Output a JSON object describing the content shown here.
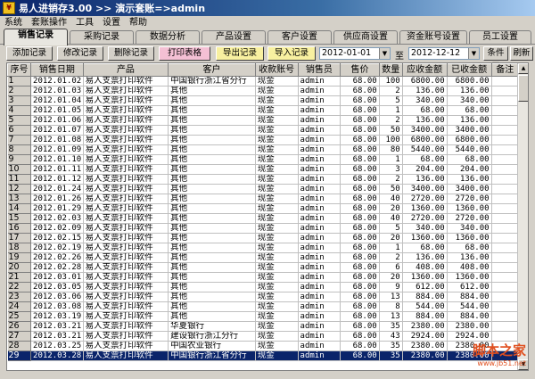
{
  "window": {
    "title": "易人进销存3.00 >> 演示套账=>admin"
  },
  "menu": [
    "系统",
    "套账操作",
    "工具",
    "设置",
    "帮助"
  ],
  "tabs": [
    {
      "label": "销售记录",
      "active": true
    },
    {
      "label": "采购记录"
    },
    {
      "label": "数据分析"
    },
    {
      "label": "产品设置"
    },
    {
      "label": "客户设置"
    },
    {
      "label": "供应商设置"
    },
    {
      "label": "资金账号设置"
    },
    {
      "label": "员工设置"
    }
  ],
  "toolbar": {
    "add": "添加记录",
    "edit": "修改记录",
    "delete": "删除记录",
    "print": "打印表格",
    "export": "导出记录",
    "import": "导入记录",
    "date_from": "2012-01-01",
    "to_label": "至",
    "date_to": "2012-12-12",
    "condition": "条件▼",
    "refresh": "刷新"
  },
  "table": {
    "columns": [
      "序号",
      "销售日期",
      "产品",
      "客户",
      "收款账号",
      "销售员",
      "售价",
      "数量",
      "应收金额",
      "已收金额",
      "备注"
    ],
    "rows": [
      [
        "1",
        "2012.01.02",
        "易人支票打印软件",
        "中国银行浙江省分行",
        "现金",
        "admin",
        "68.00",
        "100",
        "6800.00",
        "6800.00",
        ""
      ],
      [
        "2",
        "2012.01.03",
        "易人支票打印软件",
        "其他",
        "现金",
        "admin",
        "68.00",
        "2",
        "136.00",
        "136.00",
        ""
      ],
      [
        "3",
        "2012.01.04",
        "易人支票打印软件",
        "其他",
        "现金",
        "admin",
        "68.00",
        "5",
        "340.00",
        "340.00",
        ""
      ],
      [
        "4",
        "2012.01.05",
        "易人支票打印软件",
        "其他",
        "现金",
        "admin",
        "68.00",
        "1",
        "68.00",
        "68.00",
        ""
      ],
      [
        "5",
        "2012.01.06",
        "易人支票打印软件",
        "其他",
        "现金",
        "admin",
        "68.00",
        "2",
        "136.00",
        "136.00",
        ""
      ],
      [
        "6",
        "2012.01.07",
        "易人支票打印软件",
        "其他",
        "现金",
        "admin",
        "68.00",
        "50",
        "3400.00",
        "3400.00",
        ""
      ],
      [
        "7",
        "2012.01.08",
        "易人支票打印软件",
        "其他",
        "现金",
        "admin",
        "68.00",
        "100",
        "6800.00",
        "6800.00",
        ""
      ],
      [
        "8",
        "2012.01.09",
        "易人支票打印软件",
        "其他",
        "现金",
        "admin",
        "68.00",
        "80",
        "5440.00",
        "5440.00",
        ""
      ],
      [
        "9",
        "2012.01.10",
        "易人支票打印软件",
        "其他",
        "现金",
        "admin",
        "68.00",
        "1",
        "68.00",
        "68.00",
        ""
      ],
      [
        "10",
        "2012.01.11",
        "易人支票打印软件",
        "其他",
        "现金",
        "admin",
        "68.00",
        "3",
        "204.00",
        "204.00",
        ""
      ],
      [
        "11",
        "2012.01.12",
        "易人支票打印软件",
        "其他",
        "现金",
        "admin",
        "68.00",
        "2",
        "136.00",
        "136.00",
        ""
      ],
      [
        "12",
        "2012.01.24",
        "易人支票打印软件",
        "其他",
        "现金",
        "admin",
        "68.00",
        "50",
        "3400.00",
        "3400.00",
        ""
      ],
      [
        "13",
        "2012.01.26",
        "易人支票打印软件",
        "其他",
        "现金",
        "admin",
        "68.00",
        "40",
        "2720.00",
        "2720.00",
        ""
      ],
      [
        "14",
        "2012.01.29",
        "易人支票打印软件",
        "其他",
        "现金",
        "admin",
        "68.00",
        "20",
        "1360.00",
        "1360.00",
        ""
      ],
      [
        "15",
        "2012.02.03",
        "易人支票打印软件",
        "其他",
        "现金",
        "admin",
        "68.00",
        "40",
        "2720.00",
        "2720.00",
        ""
      ],
      [
        "16",
        "2012.02.09",
        "易人支票打印软件",
        "其他",
        "现金",
        "admin",
        "68.00",
        "5",
        "340.00",
        "340.00",
        ""
      ],
      [
        "17",
        "2012.02.15",
        "易人支票打印软件",
        "其他",
        "现金",
        "admin",
        "68.00",
        "20",
        "1360.00",
        "1360.00",
        ""
      ],
      [
        "18",
        "2012.02.19",
        "易人支票打印软件",
        "其他",
        "现金",
        "admin",
        "68.00",
        "1",
        "68.00",
        "68.00",
        ""
      ],
      [
        "19",
        "2012.02.26",
        "易人支票打印软件",
        "其他",
        "现金",
        "admin",
        "68.00",
        "2",
        "136.00",
        "136.00",
        ""
      ],
      [
        "20",
        "2012.02.28",
        "易人支票打印软件",
        "其他",
        "现金",
        "admin",
        "68.00",
        "6",
        "408.00",
        "408.00",
        ""
      ],
      [
        "21",
        "2012.03.01",
        "易人支票打印软件",
        "其他",
        "现金",
        "admin",
        "68.00",
        "20",
        "1360.00",
        "1360.00",
        ""
      ],
      [
        "22",
        "2012.03.05",
        "易人支票打印软件",
        "其他",
        "现金",
        "admin",
        "68.00",
        "9",
        "612.00",
        "612.00",
        ""
      ],
      [
        "23",
        "2012.03.06",
        "易人支票打印软件",
        "其他",
        "现金",
        "admin",
        "68.00",
        "13",
        "884.00",
        "884.00",
        ""
      ],
      [
        "24",
        "2012.03.08",
        "易人支票打印软件",
        "其他",
        "现金",
        "admin",
        "68.00",
        "8",
        "544.00",
        "544.00",
        ""
      ],
      [
        "25",
        "2012.03.19",
        "易人支票打印软件",
        "其他",
        "现金",
        "admin",
        "68.00",
        "13",
        "884.00",
        "884.00",
        ""
      ],
      [
        "26",
        "2012.03.21",
        "易人支票打印软件",
        "华夏银行",
        "现金",
        "admin",
        "68.00",
        "35",
        "2380.00",
        "2380.00",
        ""
      ],
      [
        "27",
        "2012.03.21",
        "易人支票打印软件",
        "建设银行浙江分行",
        "现金",
        "admin",
        "68.00",
        "43",
        "2924.00",
        "2924.00",
        ""
      ],
      [
        "28",
        "2012.03.25",
        "易人支票打印软件",
        "中国农业银行",
        "现金",
        "admin",
        "68.00",
        "35",
        "2380.00",
        "2380.00",
        ""
      ],
      [
        "29",
        "2012.03.28",
        "易人支票打印软件",
        "中国银行浙江省分行",
        "现金",
        "admin",
        "68.00",
        "35",
        "2380.00",
        "2380.00",
        ""
      ]
    ],
    "selected_row": 28
  },
  "watermark": {
    "main": "脚本之家",
    "sub": "www.jb51.net"
  }
}
